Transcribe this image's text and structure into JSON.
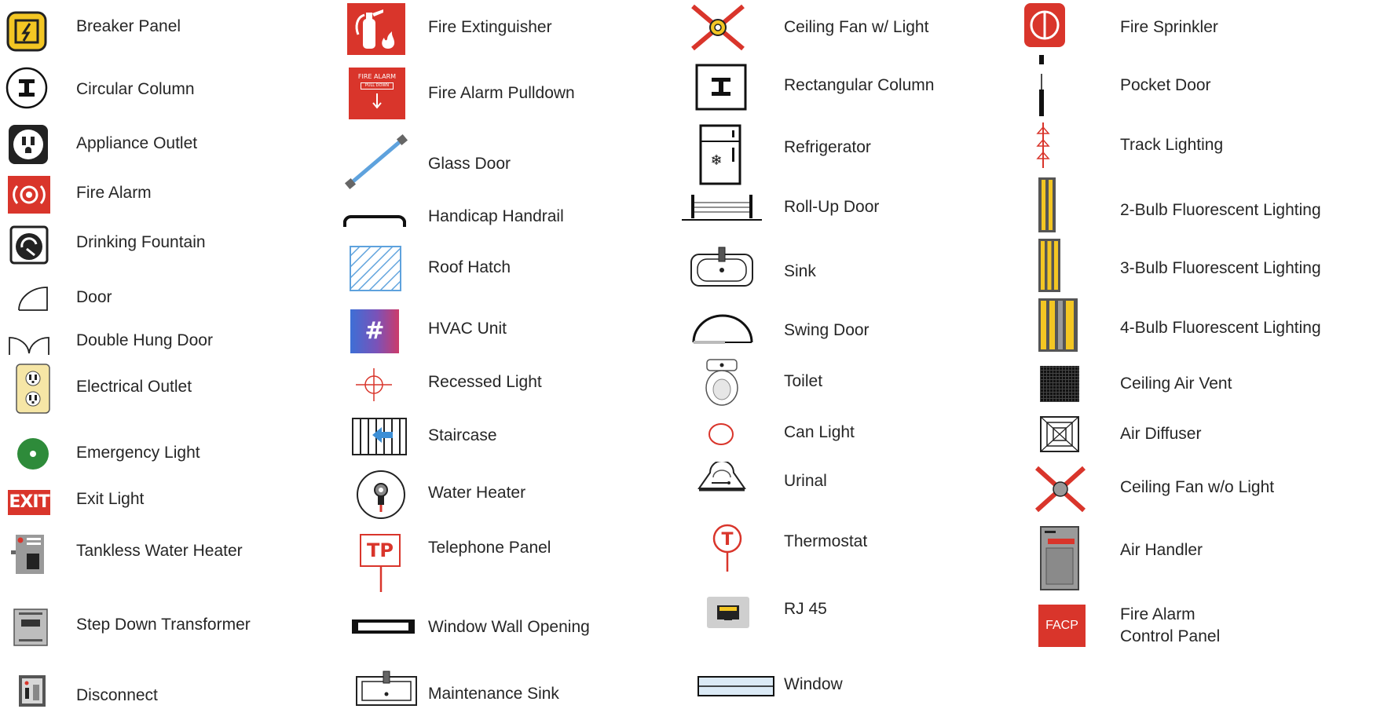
{
  "legend": {
    "breaker_panel": "Breaker Panel",
    "circular_column": "Circular Column",
    "appliance_outlet": "Appliance Outlet",
    "fire_alarm": "Fire Alarm",
    "drinking_fountain": "Drinking Fountain",
    "door": "Door",
    "double_hung_door": "Double Hung Door",
    "electrical_outlet": "Electrical Outlet",
    "emergency_light": "Emergency Light",
    "exit_light": "Exit Light",
    "tankless_water_heater": "Tankless Water Heater",
    "step_down_transformer": "Step Down Transformer",
    "disconnect": "Disconnect",
    "fire_extinguisher": "Fire Extinguisher",
    "fire_alarm_pulldown": "Fire Alarm Pulldown",
    "glass_door": "Glass Door",
    "handicap_handrail": "Handicap Handrail",
    "roof_hatch": "Roof Hatch",
    "hvac_unit": "HVAC Unit",
    "recessed_light": "Recessed Light",
    "staircase": "Staircase",
    "water_heater": "Water Heater",
    "telephone_panel": "Telephone Panel",
    "window_wall_opening": "Window Wall Opening",
    "maintenance_sink": "Maintenance Sink",
    "ceiling_fan_light": "Ceiling Fan w/ Light",
    "rectangular_column": "Rectangular Column",
    "refrigerator": "Refrigerator",
    "roll_up_door": "Roll-Up Door",
    "sink": "Sink",
    "swing_door": "Swing Door",
    "toilet": "Toilet",
    "can_light": "Can Light",
    "urinal": "Urinal",
    "thermostat": "Thermostat",
    "rj45": "RJ 45",
    "window": "Window",
    "fire_sprinkler": "Fire Sprinkler",
    "pocket_door": "Pocket Door",
    "track_lighting": "Track Lighting",
    "fluor_2": "2-Bulb Fluorescent Lighting",
    "fluor_3": "3-Bulb Fluorescent Lighting",
    "fluor_4": "4-Bulb Fluorescent Lighting",
    "ceiling_air_vent": "Ceiling Air Vent",
    "air_diffuser": "Air Diffuser",
    "ceiling_fan_no_light": "Ceiling Fan w/o Light",
    "air_handler": "Air Handler",
    "facp_line1": "Fire Alarm",
    "facp_line2": "Control Panel"
  },
  "icon_text": {
    "fire_alarm_sign": "FIRE ALARM",
    "pull_down": "PULL DOWN",
    "hvac_symbol": "#",
    "exit": "EXIT",
    "tp": "TP",
    "thermostat_t": "T",
    "facp": "FACP"
  },
  "colors": {
    "red": "#d9352b",
    "yellow": "#f3c623",
    "green": "#2e8b3a",
    "blue": "#3d8fd6",
    "gray": "#9a9a9a",
    "dark": "#1a1a1a"
  }
}
